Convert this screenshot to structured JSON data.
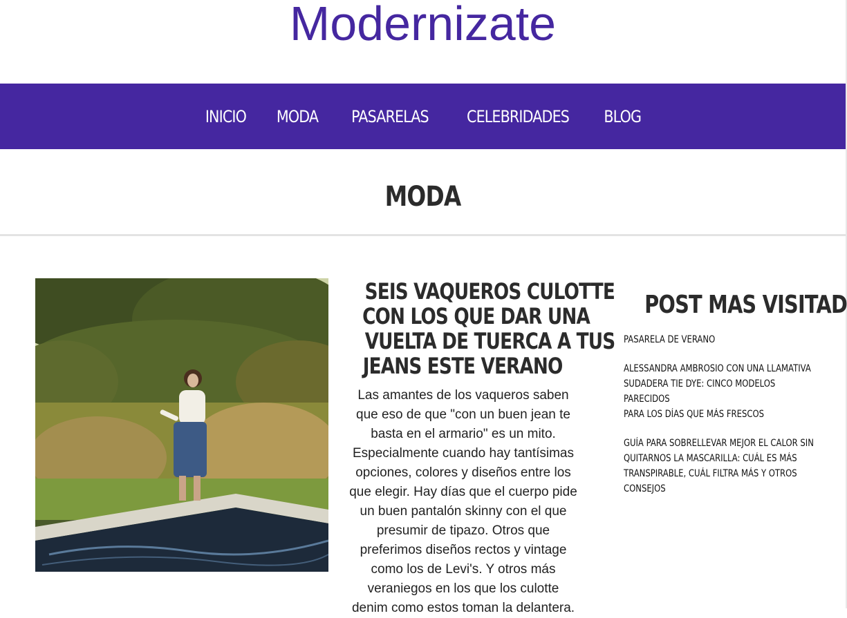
{
  "site": {
    "title": "Modernizate"
  },
  "nav": {
    "items": [
      "INICIO",
      "MODA",
      "PASARELAS",
      "CELEBRIDADES",
      "BLOG"
    ]
  },
  "page": {
    "heading": "MODA"
  },
  "article": {
    "title_lines": [
      "SEIS VAQUEROS CULOTTE",
      "CON LOS QUE DAR UNA",
      "VUELTA DE TUERCA A TUS",
      "JEANS ESTE VERANO"
    ],
    "excerpt_lines": [
      "Las amantes de los vaqueros saben",
      "que eso de que \"con un buen jean te",
      "basta en el armario\" es un mito.",
      "Especialmente cuando hay tantísimas",
      "opciones, colores y diseños entre los",
      "que elegir. Hay días que el cuerpo pide",
      "un buen pantalón skinny con el que",
      "presumir de tipazo. Otros que",
      "preferimos diseños rectos y vintage",
      "como los de Levi's. Y otros más",
      "veraniegos en los que los culotte",
      "denim como estos toman la delantera."
    ]
  },
  "sidebar": {
    "title": "POST MAS VISITADOS",
    "items": [
      [
        "PASARELA DE VERANO"
      ],
      [
        "ALESSANDRA AMBROSIO CON UNA LLAMATIVA",
        "SUDADERA TIE DYE: CINCO MODELOS PARECIDOS",
        "PARA LOS DÍAS QUE MÁS FRESCOS"
      ],
      [
        "GUÍA PARA SOBRELLEVAR MEJOR EL CALOR SIN",
        "QUITARNOS LA MASCARILLA: CUÁL ES MÁS",
        "TRANSPIRABLE, CUÁL FILTRA MÁS Y OTROS",
        "CONSEJOS"
      ]
    ]
  },
  "colors": {
    "brand": "#4527a0",
    "nav_text": "#ffffff",
    "heading": "#2b2b2b"
  },
  "icons": {
    "article_image": "woman-by-pool-photo"
  }
}
